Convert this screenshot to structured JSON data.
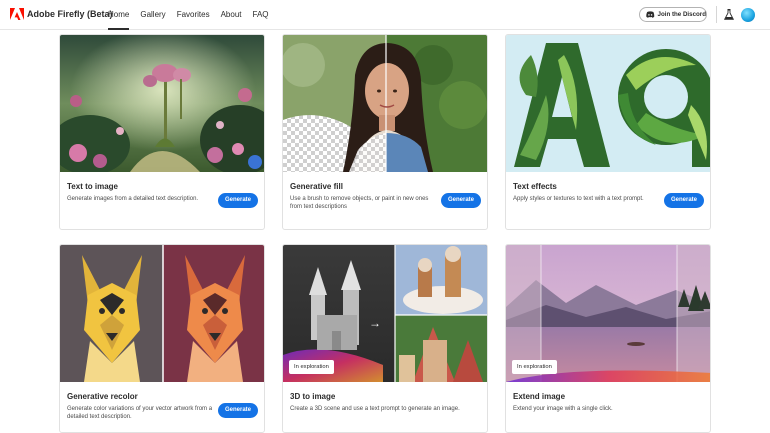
{
  "header": {
    "brand": "Adobe Firefly (Beta)",
    "logo_icon": "adobe-logo-icon",
    "nav": [
      {
        "label": "Home",
        "active": true
      },
      {
        "label": "Gallery",
        "active": false
      },
      {
        "label": "Favorites",
        "active": false
      },
      {
        "label": "About",
        "active": false
      },
      {
        "label": "FAQ",
        "active": false
      }
    ],
    "discord_label": "Join the Discord",
    "discord_icon": "discord-icon",
    "labs_icon": "flask-icon",
    "avatar_icon": "avatar"
  },
  "cards": [
    {
      "title": "Text to image",
      "desc": "Generate images from a detailed text description.",
      "button": "Generate"
    },
    {
      "title": "Generative fill",
      "desc": "Use a brush to remove objects, or paint in new ones from text descriptions",
      "button": "Generate"
    },
    {
      "title": "Text effects",
      "desc": "Apply styles or textures to text with a text prompt.",
      "button": "Generate"
    },
    {
      "title": "Generative recolor",
      "desc": "Generate color variations of your vector artwork from a detailed text description.",
      "button": "Generate"
    },
    {
      "title": "3D to image",
      "desc": "Create a 3D scene and use a text prompt to generate an image.",
      "tag": "In exploration"
    },
    {
      "title": "Extend image",
      "desc": "Extend your image with a single click.",
      "tag": "In exploration"
    }
  ],
  "colors": {
    "accent": "#1473e6",
    "text": "#2c2c2c",
    "adobe_red": "#fa0f00"
  }
}
